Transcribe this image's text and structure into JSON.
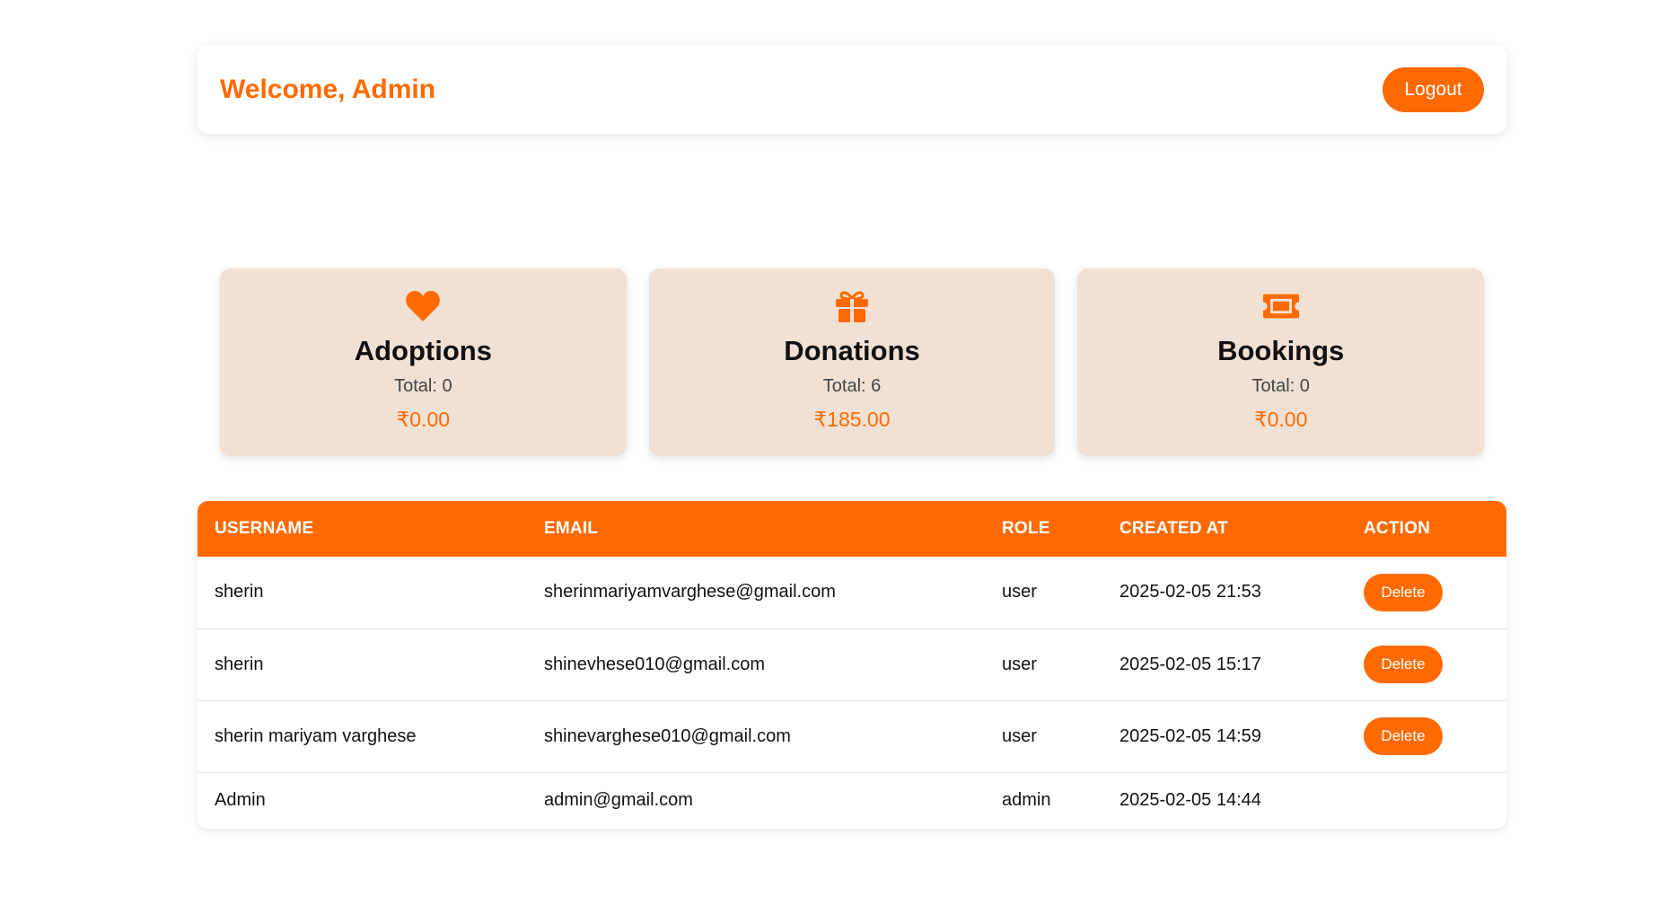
{
  "header": {
    "welcome": "Welcome, Admin",
    "logout_label": "Logout"
  },
  "cards": [
    {
      "icon": "heart-icon",
      "title": "Adoptions",
      "total": "Total: 0",
      "amount": "₹0.00"
    },
    {
      "icon": "gift-icon",
      "title": "Donations",
      "total": "Total: 6",
      "amount": "₹185.00"
    },
    {
      "icon": "ticket-icon",
      "title": "Bookings",
      "total": "Total: 0",
      "amount": "₹0.00"
    }
  ],
  "table": {
    "columns": [
      "USERNAME",
      "EMAIL",
      "ROLE",
      "CREATED AT",
      "ACTION"
    ],
    "rows": [
      {
        "username": "sherin",
        "email": "sherinmariyamvarghese@gmail.com",
        "role": "user",
        "created_at": "2025-02-05 21:53",
        "action": "Delete"
      },
      {
        "username": "sherin",
        "email": "shinevhese010@gmail.com",
        "role": "user",
        "created_at": "2025-02-05 15:17",
        "action": "Delete"
      },
      {
        "username": "sherin mariyam varghese",
        "email": "shinevarghese010@gmail.com",
        "role": "user",
        "created_at": "2025-02-05 14:59",
        "action": "Delete"
      },
      {
        "username": "Admin",
        "email": "admin@gmail.com",
        "role": "admin",
        "created_at": "2025-02-05 14:44",
        "action": ""
      }
    ]
  },
  "colors": {
    "accent": "#ff6a00",
    "card_bg": "#f0e1d4"
  }
}
